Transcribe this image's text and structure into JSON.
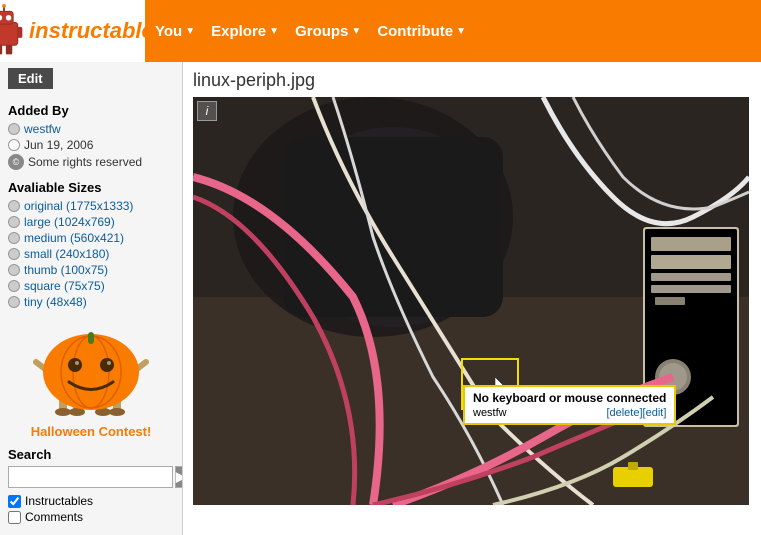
{
  "header": {
    "logo_text": "instructables",
    "nav": [
      {
        "label": "You",
        "has_arrow": true
      },
      {
        "label": "Explore",
        "has_arrow": true
      },
      {
        "label": "Groups",
        "has_arrow": true
      },
      {
        "label": "Contribute",
        "has_arrow": true
      }
    ]
  },
  "sidebar": {
    "edit_label": "Edit",
    "added_by_title": "Added By",
    "author": "westfw",
    "date": "Jun 19, 2006",
    "rights": "Some rights reserved",
    "sizes_title": "Avaliable Sizes",
    "sizes": [
      {
        "label": "original (1775x1333)",
        "value": "original"
      },
      {
        "label": "large (1024x769)",
        "value": "large"
      },
      {
        "label": "medium (560x421)",
        "value": "medium"
      },
      {
        "label": "small (240x180)",
        "value": "small"
      },
      {
        "label": "thumb (100x75)",
        "value": "thumb"
      },
      {
        "label": "square (75x75)",
        "value": "square"
      },
      {
        "label": "tiny (48x48)",
        "value": "tiny"
      }
    ],
    "halloween_link": "Halloween Contest!",
    "search_label": "Search",
    "search_placeholder": "",
    "search_btn_icon": "▶",
    "checkboxes": [
      {
        "label": "Instructables",
        "checked": true
      },
      {
        "label": "Comments",
        "checked": false
      }
    ]
  },
  "main": {
    "image_title": "linux-periph.jpg",
    "info_btn": "i",
    "tooltip": {
      "title": "No keyboard or mouse connected",
      "author": "westfw",
      "delete_label": "[delete]",
      "edit_label": "[edit]"
    }
  }
}
